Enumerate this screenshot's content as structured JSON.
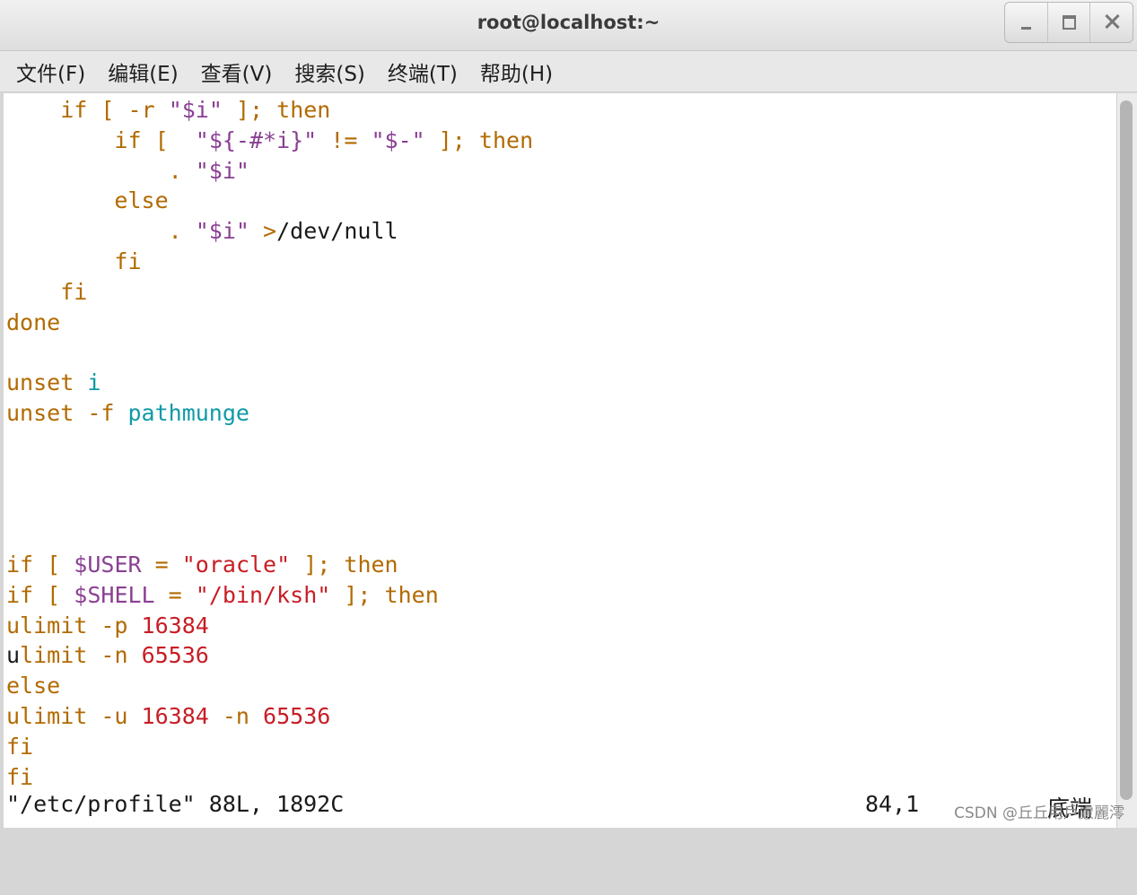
{
  "window": {
    "title": "root@localhost:~"
  },
  "menu": [
    "文件(F)",
    "编辑(E)",
    "查看(V)",
    "搜索(S)",
    "终端(T)",
    "帮助(H)"
  ],
  "lines": [
    [
      {
        "t": "    "
      },
      {
        "t": "if",
        "c": "kw"
      },
      {
        "t": " "
      },
      {
        "t": "[",
        "c": "kw"
      },
      {
        "t": " "
      },
      {
        "t": "-r",
        "c": "kw"
      },
      {
        "t": " "
      },
      {
        "t": "\"$i\"",
        "c": "var"
      },
      {
        "t": " "
      },
      {
        "t": "];",
        "c": "kw"
      },
      {
        "t": " "
      },
      {
        "t": "then",
        "c": "kw"
      }
    ],
    [
      {
        "t": "        "
      },
      {
        "t": "if",
        "c": "kw"
      },
      {
        "t": " "
      },
      {
        "t": "[",
        "c": "kw"
      },
      {
        "t": "  "
      },
      {
        "t": "\"${-#*i}\"",
        "c": "var"
      },
      {
        "t": " "
      },
      {
        "t": "!=",
        "c": "kw"
      },
      {
        "t": " "
      },
      {
        "t": "\"$-\"",
        "c": "var"
      },
      {
        "t": " "
      },
      {
        "t": "];",
        "c": "kw"
      },
      {
        "t": " "
      },
      {
        "t": "then",
        "c": "kw"
      }
    ],
    [
      {
        "t": "            "
      },
      {
        "t": ".",
        "c": "kw"
      },
      {
        "t": " "
      },
      {
        "t": "\"$i\"",
        "c": "var"
      }
    ],
    [
      {
        "t": "        "
      },
      {
        "t": "else",
        "c": "kw"
      }
    ],
    [
      {
        "t": "            "
      },
      {
        "t": ".",
        "c": "kw"
      },
      {
        "t": " "
      },
      {
        "t": "\"$i\"",
        "c": "var"
      },
      {
        "t": " "
      },
      {
        "t": ">",
        "c": "kw"
      },
      {
        "t": "/dev/null",
        "c": "txt"
      }
    ],
    [
      {
        "t": "        "
      },
      {
        "t": "fi",
        "c": "kw"
      }
    ],
    [
      {
        "t": "    "
      },
      {
        "t": "fi",
        "c": "kw"
      }
    ],
    [
      {
        "t": "done",
        "c": "kw"
      }
    ],
    [],
    [
      {
        "t": "unset",
        "c": "kw"
      },
      {
        "t": " "
      },
      {
        "t": "i",
        "c": "id"
      }
    ],
    [
      {
        "t": "unset",
        "c": "kw"
      },
      {
        "t": " "
      },
      {
        "t": "-f",
        "c": "kw"
      },
      {
        "t": " "
      },
      {
        "t": "pathmunge",
        "c": "id"
      }
    ],
    [],
    [],
    [],
    [],
    [
      {
        "t": "if",
        "c": "kw"
      },
      {
        "t": " "
      },
      {
        "t": "[",
        "c": "kw"
      },
      {
        "t": " "
      },
      {
        "t": "$USER",
        "c": "var"
      },
      {
        "t": " "
      },
      {
        "t": "=",
        "c": "kw"
      },
      {
        "t": " "
      },
      {
        "t": "\"oracle\"",
        "c": "str"
      },
      {
        "t": " "
      },
      {
        "t": "];",
        "c": "kw"
      },
      {
        "t": " "
      },
      {
        "t": "then",
        "c": "kw"
      }
    ],
    [
      {
        "t": "if",
        "c": "kw"
      },
      {
        "t": " "
      },
      {
        "t": "[",
        "c": "kw"
      },
      {
        "t": " "
      },
      {
        "t": "$SHELL",
        "c": "var"
      },
      {
        "t": " "
      },
      {
        "t": "=",
        "c": "kw"
      },
      {
        "t": " "
      },
      {
        "t": "\"/bin/ksh\"",
        "c": "str"
      },
      {
        "t": " "
      },
      {
        "t": "];",
        "c": "kw"
      },
      {
        "t": " "
      },
      {
        "t": "then",
        "c": "kw"
      }
    ],
    [
      {
        "t": "ulimit",
        "c": "kw"
      },
      {
        "t": " "
      },
      {
        "t": "-p",
        "c": "kw"
      },
      {
        "t": " "
      },
      {
        "t": "16384",
        "c": "str"
      }
    ],
    [
      {
        "t": "u",
        "c": "cursor"
      },
      {
        "t": "limit",
        "c": "kw"
      },
      {
        "t": " "
      },
      {
        "t": "-n",
        "c": "kw"
      },
      {
        "t": " "
      },
      {
        "t": "65536",
        "c": "str"
      }
    ],
    [
      {
        "t": "else",
        "c": "kw"
      }
    ],
    [
      {
        "t": "ulimit",
        "c": "kw"
      },
      {
        "t": " "
      },
      {
        "t": "-u",
        "c": "kw"
      },
      {
        "t": " "
      },
      {
        "t": "16384",
        "c": "str"
      },
      {
        "t": " "
      },
      {
        "t": "-n",
        "c": "kw"
      },
      {
        "t": " "
      },
      {
        "t": "65536",
        "c": "str"
      }
    ],
    [
      {
        "t": "fi",
        "c": "kw"
      }
    ],
    [
      {
        "t": "fi",
        "c": "kw"
      }
    ]
  ],
  "status": {
    "file": "\"/etc/profile\" 88L, 1892C",
    "position": "84,1",
    "where": "底端"
  },
  "watermark": "CSDN @丘丘用戶慮麗澪",
  "colors": {
    "keyword": "#b26a00",
    "string": "#c81d25",
    "variable": "#8a3f93",
    "identifier": "#0f9aa6"
  }
}
